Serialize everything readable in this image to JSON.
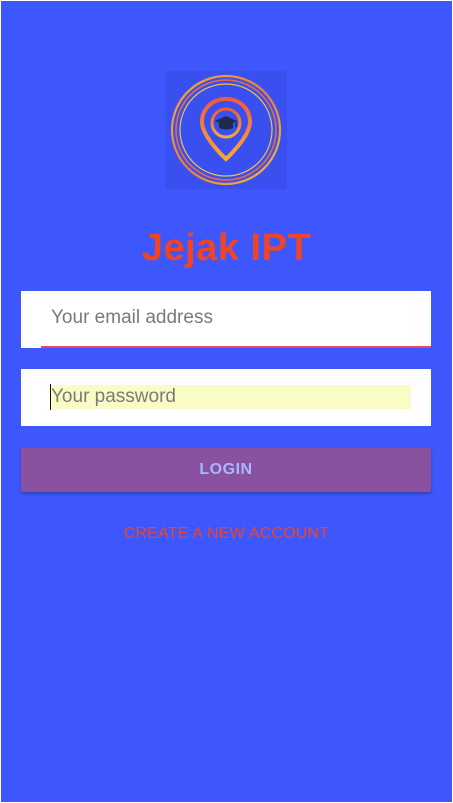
{
  "app": {
    "title": "Jejak IPT",
    "logo_icon": "graduation-cap-location-pin-icon"
  },
  "form": {
    "email": {
      "placeholder": "Your email address",
      "value": ""
    },
    "password": {
      "placeholder": "Your password",
      "value": ""
    },
    "login_label": "LOGIN",
    "create_account_label": "CREATE A NEW ACCOUNT"
  },
  "colors": {
    "background": "#3d57fd",
    "title": "#f04424",
    "login_button": "#8b51a1",
    "login_text": "#a8b7ff",
    "email_underline": "#e8456a",
    "autofill_highlight": "#fafcc6"
  }
}
